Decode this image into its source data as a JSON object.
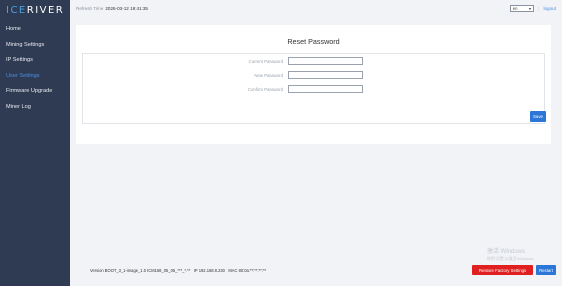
{
  "brand": {
    "prefix": "ICE",
    "suffix": "RIVER"
  },
  "sidebar": {
    "items": [
      {
        "label": "Home"
      },
      {
        "label": "Mining Settings"
      },
      {
        "label": "IP Settings"
      },
      {
        "label": "User Settings",
        "active": true
      },
      {
        "label": "Firmware Upgrade"
      },
      {
        "label": "Miner Log"
      }
    ]
  },
  "header": {
    "refresh_label": "Refresh Time",
    "refresh_time": "2026-03-12 19:41:35",
    "language": "en",
    "logout_label": "logout"
  },
  "main": {
    "title": "Reset Password",
    "fields": [
      {
        "label": "Current Password",
        "value": ""
      },
      {
        "label": "New Password",
        "value": ""
      },
      {
        "label": "Confirm Password",
        "value": ""
      }
    ],
    "save_label": "Save"
  },
  "footer": {
    "version_label": "Version",
    "version_value": "BOOT_3_1-image_1.0 ICM168_05_05_***_*.**",
    "ip_label": "IP",
    "ip_value": "192.168.8.230",
    "mac_label": "MAC",
    "mac_value": "80:0a:**:**:**:**",
    "restore_label": "Restore Factory Settings",
    "restart_label": "Restart"
  },
  "watermark": {
    "line1": "激活 Windows",
    "line2": "转到\"设置\"以激活 Windows。"
  },
  "colors": {
    "sidebar_bg": "#2f3b52",
    "accent": "#2b76d6",
    "danger": "#e02020",
    "active_nav": "#4d8fe0"
  }
}
